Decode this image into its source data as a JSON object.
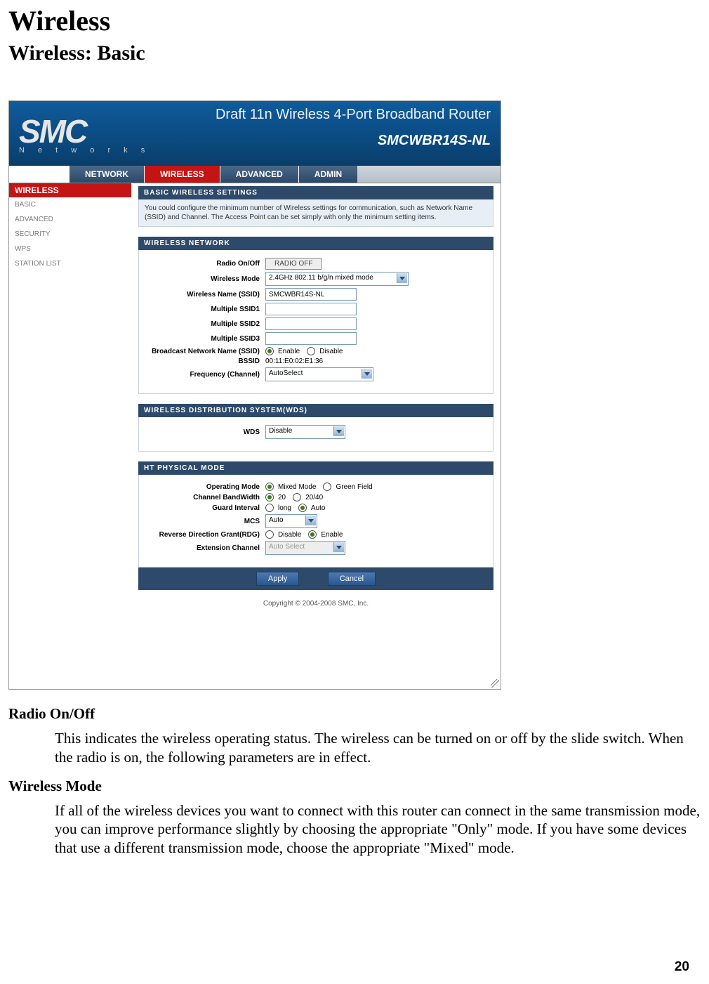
{
  "page": {
    "h1": "Wireless",
    "h2": "Wireless: Basic",
    "number": "20"
  },
  "router": {
    "brand_top": "SMC",
    "brand_bottom": "N e t w o r k s",
    "title": "Draft 11n Wireless 4-Port Broadband Router",
    "model": "SMCWBR14S-NL",
    "topnav": [
      "NETWORK",
      "WIRELESS",
      "ADVANCED",
      "ADMIN"
    ],
    "topnav_active": 1,
    "sidebar_head": "WIRELESS",
    "sidebar_items": [
      "BASIC",
      "ADVANCED",
      "SECURITY",
      "WPS",
      "STATION LIST"
    ],
    "sections": {
      "basic": {
        "head": "BASIC WIRELESS SETTINGS",
        "desc": "You could configure the minimum number of Wireless settings for communication, such as Network Name (SSID) and Channel. The Access Point can be set simply with only the minimum setting items."
      },
      "wnet": {
        "head": "WIRELESS NETWORK",
        "rows": {
          "radio_label": "Radio On/Off",
          "radio_btn": "RADIO OFF",
          "mode_label": "Wireless Mode",
          "mode_value": "2.4GHz 802.11 b/g/n mixed mode",
          "ssid_label": "Wireless Name (SSID)",
          "ssid_value": "SMCWBR14S-NL",
          "mssid1_label": "Multiple SSID1",
          "mssid2_label": "Multiple SSID2",
          "mssid3_label": "Multiple SSID3",
          "bcast_label": "Broadcast Network Name (SSID)",
          "bcast_enable": "Enable",
          "bcast_disable": "Disable",
          "bssid_label": "BSSID",
          "bssid_value": "00:11:E0:02:E1:36",
          "freq_label": "Frequency (Channel)",
          "freq_value": "AutoSelect"
        }
      },
      "wds": {
        "head": "WIRELESS DISTRIBUTION SYSTEM(WDS)",
        "label": "WDS",
        "value": "Disable"
      },
      "ht": {
        "head": "HT PHYSICAL MODE",
        "op_label": "Operating Mode",
        "op_a": "Mixed Mode",
        "op_b": "Green Field",
        "bw_label": "Channel BandWidth",
        "bw_a": "20",
        "bw_b": "20/40",
        "gi_label": "Guard Interval",
        "gi_a": "long",
        "gi_b": "Auto",
        "mcs_label": "MCS",
        "mcs_value": "Auto",
        "rdg_label": "Reverse Direction Grant(RDG)",
        "rdg_a": "Disable",
        "rdg_b": "Enable",
        "ext_label": "Extension Channel",
        "ext_value": "Auto Select"
      }
    },
    "actions": {
      "apply": "Apply",
      "cancel": "Cancel"
    },
    "copyright": "Copyright © 2004-2008 SMC, Inc."
  },
  "doc": {
    "radio_h": "Radio On/Off",
    "radio_p": "This indicates the wireless operating status. The wireless can be turned on or off by the slide switch. When the radio is on, the following parameters are in effect.",
    "mode_h": "Wireless Mode",
    "mode_p": "If all of the wireless devices you want to connect with this router can connect in the same transmission mode, you can improve performance slightly by choosing the appropriate \"Only\" mode. If you have some devices that use a different transmission mode, choose the appropriate \"Mixed\" mode."
  }
}
